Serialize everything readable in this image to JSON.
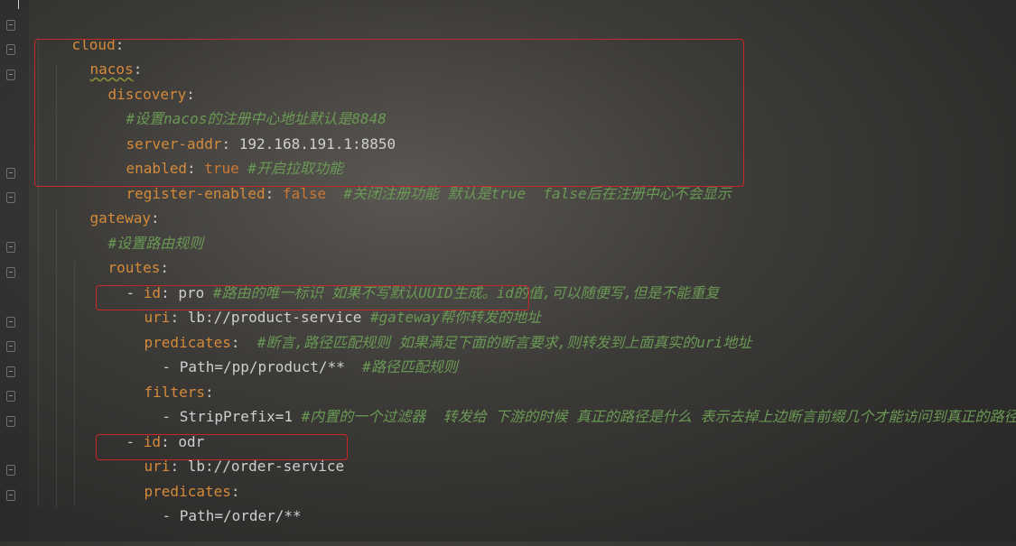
{
  "editor": {
    "lines": [
      {
        "key": "cloud",
        "sep": ":",
        "value": "",
        "comment": ""
      },
      {
        "key": "nacos",
        "sep": ":",
        "value": "",
        "comment": ""
      },
      {
        "key": "discovery",
        "sep": ":",
        "value": "",
        "comment": ""
      },
      {
        "key": "",
        "sep": "",
        "value": "",
        "comment": "#设置nacos的注册中心地址默认是8848"
      },
      {
        "key": "server-addr",
        "sep": ":",
        "value": " 192.168.191.1:8850",
        "comment": ""
      },
      {
        "key": "enabled",
        "sep": ":",
        "value": " true",
        "comment": " #开启拉取功能"
      },
      {
        "key": "register-enabled",
        "sep": ":",
        "value": " false",
        "comment": "  #关闭注册功能 默认是true  false后在注册中心不会显示"
      },
      {
        "key": "gateway",
        "sep": ":",
        "value": "",
        "comment": ""
      },
      {
        "key": "",
        "sep": "",
        "value": "",
        "comment": "#设置路由规则"
      },
      {
        "key": "routes",
        "sep": ":",
        "value": "",
        "comment": ""
      },
      {
        "dash": "- ",
        "key": "id",
        "sep": ":",
        "value": " pro",
        "comment": " #路由的唯一标识 如果不写默认UUID生成。id的值,可以随便写,但是不能重复"
      },
      {
        "key": "uri",
        "sep": ":",
        "value": " lb://product-service",
        "comment": " #gateway帮你转发的地址"
      },
      {
        "key": "predicates",
        "sep": ":",
        "value": "",
        "comment": "  #断言,路径匹配规则 如果满足下面的断言要求,则转发到上面真实的uri地址"
      },
      {
        "dash": "- ",
        "key": "",
        "sep": "",
        "value": "Path=/pp/product/**",
        "comment": "  #路径匹配规则"
      },
      {
        "key": "filters",
        "sep": ":",
        "value": "",
        "comment": ""
      },
      {
        "dash": "- ",
        "key": "",
        "sep": "",
        "value": "StripPrefix=1",
        "comment": " #内置的一个过滤器  转发给 下游的时候 真正的路径是什么 表示去掉上边断言前缀几个才能访问到真正的路径"
      },
      {
        "dash": "- ",
        "key": "id",
        "sep": ":",
        "value": " odr",
        "comment": ""
      },
      {
        "key": "uri",
        "sep": ":",
        "value": " lb://order-service",
        "comment": ""
      },
      {
        "key": "predicates",
        "sep": ":",
        "value": "",
        "comment": ""
      },
      {
        "dash": "- ",
        "key": "",
        "sep": "",
        "value": "Path=/order/**",
        "comment": ""
      }
    ]
  },
  "colors": {
    "key": "#d48a3a",
    "comment": "#6a9955",
    "highlight_box": "#c62828"
  }
}
